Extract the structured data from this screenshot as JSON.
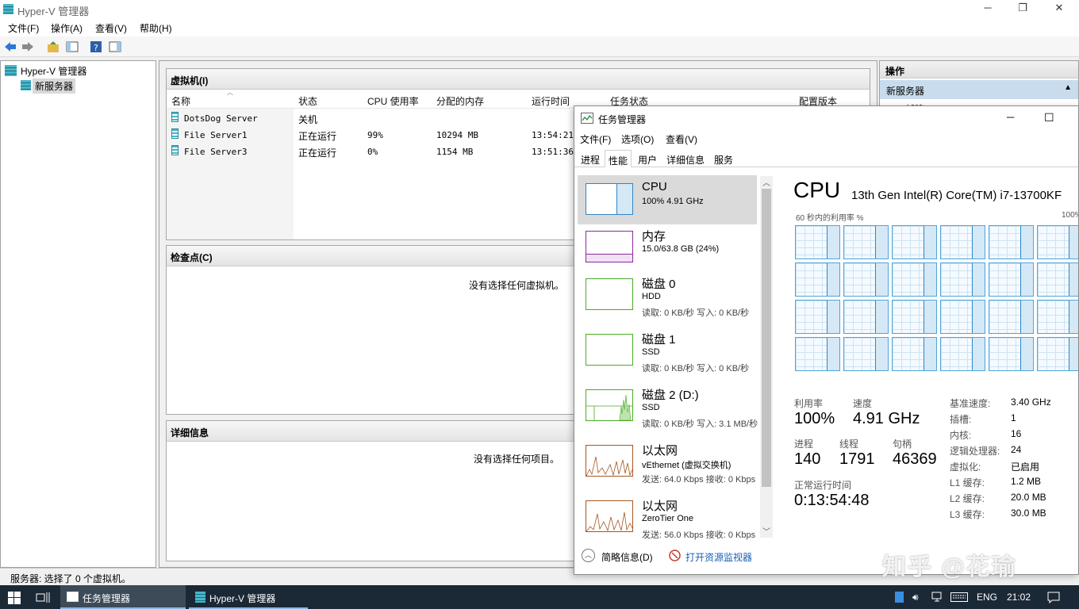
{
  "hyperv": {
    "title": "Hyper-V 管理器",
    "menu": [
      "文件(F)",
      "操作(A)",
      "查看(V)",
      "帮助(H)"
    ],
    "tree": {
      "root": "Hyper-V 管理器",
      "server": "新服务器"
    },
    "vm_panel": {
      "title": "虚拟机(I)",
      "columns": [
        "名称",
        "状态",
        "CPU 使用率",
        "分配的内存",
        "运行时间",
        "任务状态",
        "配置版本"
      ],
      "rows": [
        {
          "name": "DotsDog Server",
          "state": "关机",
          "cpu": "",
          "mem": "",
          "uptime": ""
        },
        {
          "name": "File Server1",
          "state": "正在运行",
          "cpu": "99%",
          "mem": "10294 MB",
          "uptime": "13:54:21"
        },
        {
          "name": "File Server3",
          "state": "正在运行",
          "cpu": "0%",
          "mem": "1154 MB",
          "uptime": "13:51:36"
        }
      ]
    },
    "checkpoint_panel": {
      "title": "检查点(C)",
      "empty": "没有选择任何虚拟机。"
    },
    "details_panel": {
      "title": "详细信息",
      "empty": "没有选择任何项目。"
    },
    "actions": {
      "title": "操作",
      "section": "新服务器",
      "item": "新建"
    },
    "status": "服务器: 选择了 0 个虚拟机。"
  },
  "taskmgr": {
    "title": "任务管理器",
    "menu": [
      "文件(F)",
      "选项(O)",
      "查看(V)"
    ],
    "tabs": [
      "进程",
      "性能",
      "用户",
      "详细信息",
      "服务"
    ],
    "sidebar": [
      {
        "name": "CPU",
        "sub": "100% 4.91 GHz",
        "sub2": ""
      },
      {
        "name": "内存",
        "sub": "15.0/63.8 GB (24%)",
        "sub2": ""
      },
      {
        "name": "磁盘 0",
        "sub": "HDD",
        "sub2": "读取: 0 KB/秒 写入: 0 KB/秒"
      },
      {
        "name": "磁盘 1",
        "sub": "SSD",
        "sub2": "读取: 0 KB/秒 写入: 0 KB/秒"
      },
      {
        "name": "磁盘 2 (D:)",
        "sub": "SSD",
        "sub2": "读取: 0 KB/秒 写入: 3.1 MB/秒"
      },
      {
        "name": "以太网",
        "sub": "vEthernet (虚拟交换机)",
        "sub2": "发送: 64.0 Kbps 接收: 0 Kbps"
      },
      {
        "name": "以太网",
        "sub": "ZeroTier One",
        "sub2": "发送: 56.0 Kbps 接收: 0 Kbps"
      }
    ],
    "cpu": {
      "heading": "CPU",
      "model": "13th Gen Intel(R) Core(TM) i7-13700KF",
      "graph_label": "60 秒内的利用率 %",
      "graph_max": "100%",
      "util_label": "利用率",
      "util": "100%",
      "speed_label": "速度",
      "speed": "4.91 GHz",
      "proc_label": "进程",
      "proc": "140",
      "thread_label": "线程",
      "thread": "1791",
      "handle_label": "句柄",
      "handle": "46369",
      "uptime_label": "正常运行时间",
      "uptime": "0:13:54:48",
      "specs": [
        [
          "基准速度:",
          "3.40 GHz"
        ],
        [
          "插槽:",
          "1"
        ],
        [
          "内核:",
          "16"
        ],
        [
          "逻辑处理器:",
          "24"
        ],
        [
          "虚拟化:",
          "已启用"
        ],
        [
          "L1 缓存:",
          "1.2 MB"
        ],
        [
          "L2 缓存:",
          "20.0 MB"
        ],
        [
          "L3 缓存:",
          "30.0 MB"
        ]
      ]
    },
    "footer": {
      "brief": "简略信息(D)",
      "monitor": "打开资源监视器"
    }
  },
  "taskbar": {
    "items": [
      "任务管理器",
      "Hyper-V 管理器"
    ],
    "lang": "ENG",
    "time": "21:02"
  },
  "watermark": "知乎 @花瑜"
}
